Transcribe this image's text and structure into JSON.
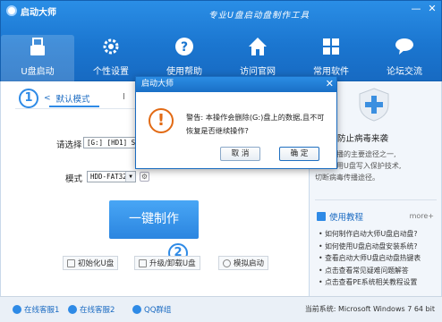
{
  "app": {
    "title": "启动大师",
    "slogan": "专业U盘启动盘制作工具"
  },
  "window_controls": {
    "minimize": "—",
    "close": "✕"
  },
  "nav": [
    {
      "label": "U盘启动",
      "icon": "usb-icon",
      "active": true
    },
    {
      "label": "个性设置",
      "icon": "gear-icon"
    },
    {
      "label": "使用帮助",
      "icon": "help-icon"
    },
    {
      "label": "访问官网",
      "icon": "home-icon"
    },
    {
      "label": "常用软件",
      "icon": "apps-icon"
    },
    {
      "label": "论坛交流",
      "icon": "chat-icon"
    }
  ],
  "mode": {
    "step": "1",
    "default_tab": "默认模式",
    "other_tab": "I"
  },
  "form": {
    "select_label": "请选择",
    "select_value": "[G:] [HD1] Sa",
    "mode_label": "模式",
    "mode_value": "HDD-FAT32"
  },
  "make_button": "一键制作",
  "step2": "2",
  "tools": [
    {
      "label": "初始化U盘"
    },
    {
      "label": "升级/卸载U盘"
    },
    {
      "label": "模拟启动"
    }
  ],
  "security": {
    "title": "保护, 防止病毒来袭",
    "lines": [
      "病毒传播的主要途径之一,",
      "大师采用U盘写入保护技术,",
      "切断病毒传播途径。"
    ]
  },
  "tutorial": {
    "title": "使用教程",
    "more": "more+",
    "items": [
      "• 如何制作启动大师U盘启动盘?",
      "• 如何使用U盘启动盘安装系统?",
      "• 查看启动大师U盘启动盘热键表",
      "• 点击查看常见疑难问题解答",
      "• 点击查看PE系统相关教程设置"
    ]
  },
  "footer": {
    "service1": "在线客服1",
    "service2": "在线客服2",
    "qq_group": "QQ群组",
    "version": "当前系统: Microsoft Windows 7 64 bit"
  },
  "dialog": {
    "title": "启动大师",
    "close": "✕",
    "message": "警告: 本操作会删除(G:)盘上的数据,且不可恢复是否继续操作?",
    "cancel": "取 消",
    "ok": "确 定"
  },
  "colors": {
    "accent": "#1b76d0",
    "warning": "#e26a14"
  }
}
